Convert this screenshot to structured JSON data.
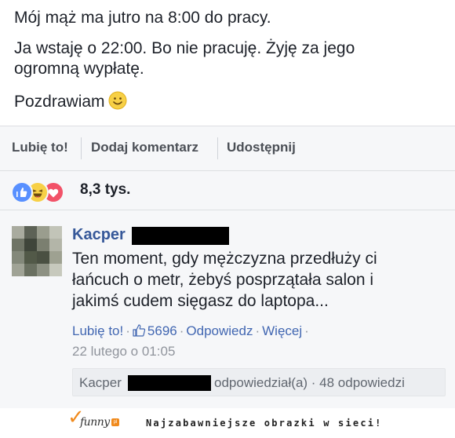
{
  "post": {
    "line1": "Mój mąż ma jutro na 8:00 do pracy.",
    "line2": "Ja wstaję o 22:00. Bo nie pracuję. Żyję za jego ogromną wypłatę.",
    "line3": "Pozdrawiam",
    "emoji": "smiley-face-icon"
  },
  "actions": {
    "like": "Lubię to!",
    "comment": "Dodaj komentarz",
    "share": "Udostępnij"
  },
  "reactions": {
    "icons": [
      "like-reaction-icon",
      "haha-reaction-icon",
      "love-reaction-icon"
    ],
    "count": "8,3 tys."
  },
  "comment": {
    "author": "Kacper",
    "text": "Ten moment, gdy mężczyzna przedłuży ci łańcuch o metr, żebyś posprzątała salon i jakimś cudem sięgasz do laptopa...",
    "like_label": "Lubię to!",
    "likes": "5696",
    "reply_label": "Odpowiedz",
    "more_label": "Więcej",
    "date": "22 lutego o 01:05",
    "reply_summary": {
      "name": "Kacper",
      "text": "odpowiedział(a) · 48 odpowiedzi"
    }
  },
  "footer": {
    "logo": "funny",
    "tagline": "Najzabawniejsze obrazki w sieci!"
  },
  "colors": {
    "link": "#4267b2",
    "author": "#365899",
    "muted": "#90949c",
    "like_reaction": "#5890ff",
    "haha_reaction": "#f7d046",
    "love_reaction": "#f25268",
    "brand_orange": "#f08a1d"
  }
}
